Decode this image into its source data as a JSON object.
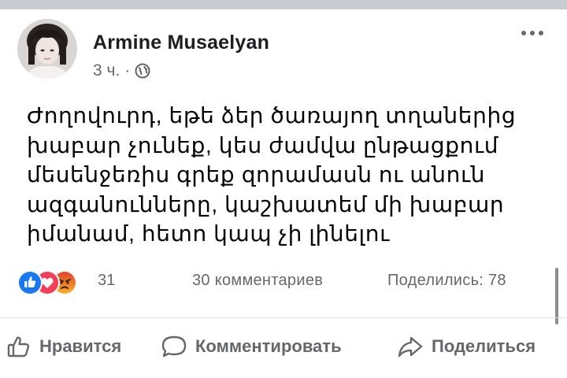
{
  "post": {
    "author": "Armine Musaelyan",
    "time": "3 ч.",
    "separator": "·",
    "privacy_icon": "globe-icon",
    "more_icon": "more-options-icon",
    "text_lines": [
      "Ժողովուրդ, եթե ձեր ծառայող տղաներից",
      "խաբար չունեք, կես ժամվա ընթացքում",
      "մեսենջեռիս գրեք զորամասն ու անուն",
      "ազգանունները, կաշխատեմ մի խաբար",
      "իմանամ, հետո կապ չի լինելու"
    ]
  },
  "stats": {
    "reaction_icons": [
      "like-icon",
      "love-icon",
      "angry-icon"
    ],
    "reactions_count": "31",
    "comments": "30 комментариев",
    "shares": "Поделились: 78"
  },
  "actions": {
    "like": "Нравится",
    "comment": "Комментировать",
    "share": "Поделиться"
  },
  "colors": {
    "like_blue": "#1877f2",
    "love_red": "#f33e58",
    "angry_orange": "#e9710f",
    "secondary_text": "#65676b"
  }
}
